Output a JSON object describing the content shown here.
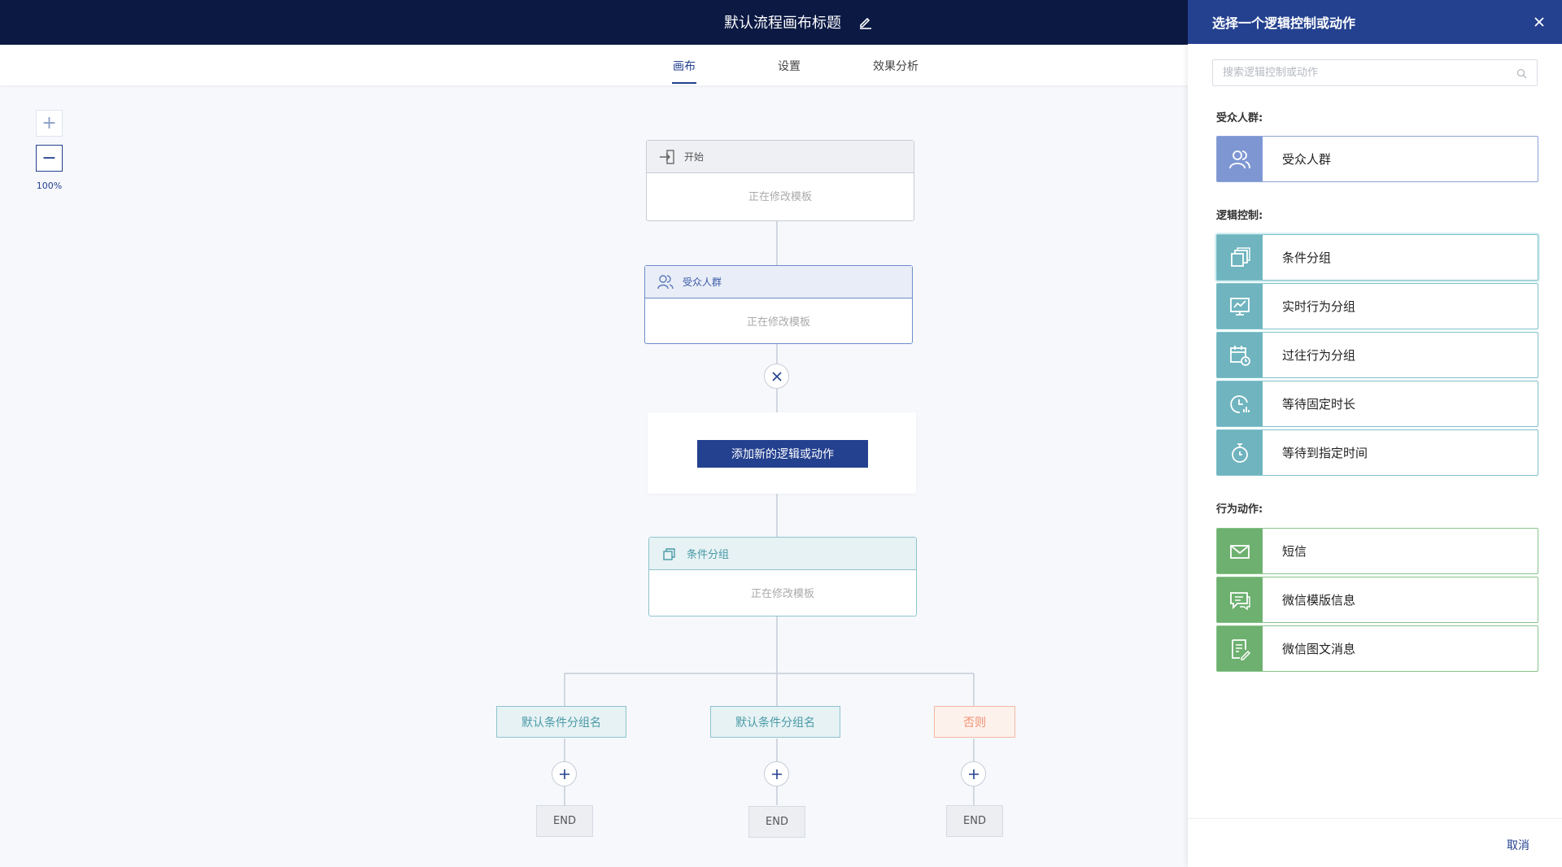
{
  "header": {
    "title": "默认流程画布标题"
  },
  "tabs": [
    {
      "label": "画布"
    },
    {
      "label": "设置"
    },
    {
      "label": "效果分析"
    }
  ],
  "zoom": {
    "plus": "+",
    "minus": "−",
    "level": "100%"
  },
  "canvas": {
    "start_node": {
      "title": "开始",
      "body": "正在修改模板"
    },
    "audience_node": {
      "title": "受众人群",
      "body": "正在修改模板"
    },
    "add_action_button": "添加新的逻辑或动作",
    "condition_node": {
      "title": "条件分组",
      "body": "正在修改模板"
    },
    "branches": [
      {
        "label": "默认条件分组名",
        "end": "END"
      },
      {
        "label": "默认条件分组名",
        "end": "END"
      },
      {
        "label": "否则",
        "end": "END"
      }
    ]
  },
  "panel": {
    "title": "选择一个逻辑控制或动作",
    "search_placeholder": "搜索逻辑控制或动作",
    "sections": [
      {
        "title": "受众人群:",
        "items": [
          {
            "label": "受众人群",
            "icon": "users-icon"
          }
        ]
      },
      {
        "title": "逻辑控制:",
        "items": [
          {
            "label": "条件分组",
            "icon": "copy-group-icon"
          },
          {
            "label": "实时行为分组",
            "icon": "monitor-chart-icon"
          },
          {
            "label": "过往行为分组",
            "icon": "calendar-clock-icon"
          },
          {
            "label": "等待固定时长",
            "icon": "clock-chart-icon"
          },
          {
            "label": "等待到指定时间",
            "icon": "stopwatch-icon"
          }
        ]
      },
      {
        "title": "行为动作:",
        "items": [
          {
            "label": "短信",
            "icon": "mail-icon"
          },
          {
            "label": "微信模版信息",
            "icon": "chat-icon"
          },
          {
            "label": "微信图文消息",
            "icon": "document-edit-icon"
          }
        ]
      }
    ],
    "cancel": "取消"
  },
  "colors": {
    "navy": "#0b1943",
    "primary": "#24418f",
    "audience": "#7e97d3",
    "logic": "#6fb4bf",
    "action": "#6db06f",
    "else": "#ee9070"
  }
}
